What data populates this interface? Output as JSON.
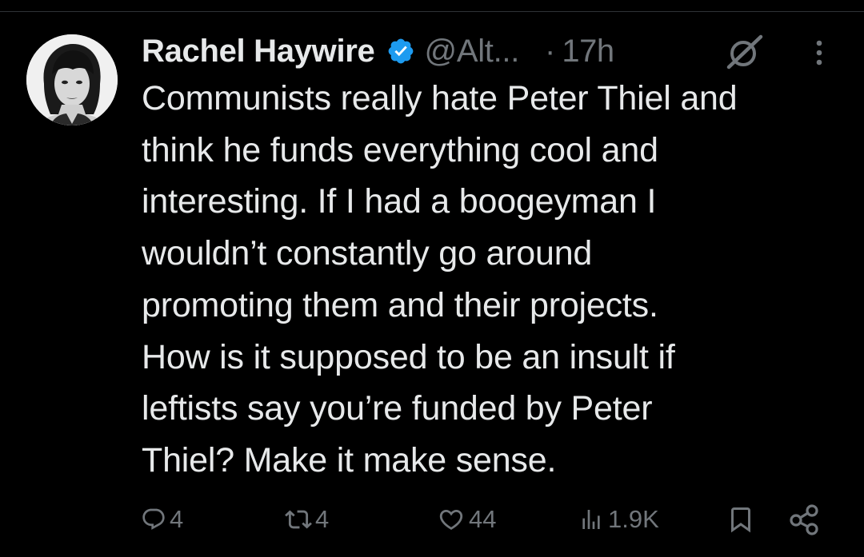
{
  "author": {
    "name": "Rachel Haywire",
    "handle": "@Alt...",
    "verified": true
  },
  "tweet": {
    "separator": "·",
    "time": "17h",
    "text": "Communists really hate Peter Thiel and\nthink he funds everything cool and\ninteresting. If I had a boogeyman I\nwouldn’t constantly go around\npromoting them and their projects.\nHow is it supposed to be an insult if\nleftists say you’re funded by Peter\nThiel? Make it make sense."
  },
  "actions": {
    "replies": "4",
    "reposts": "4",
    "likes": "44",
    "views": "1.9K"
  },
  "icons": {
    "verified": "verified-badge-icon",
    "grok": "grok-icon",
    "more": "more-vertical-icon",
    "reply": "reply-icon",
    "repost": "repost-icon",
    "like": "heart-icon",
    "views": "views-icon",
    "bookmark": "bookmark-icon",
    "share": "share-icon"
  },
  "colors": {
    "background": "#000000",
    "text_primary": "#e7e9ea",
    "text_secondary": "#71767b",
    "verified_blue": "#1d9bf0"
  }
}
